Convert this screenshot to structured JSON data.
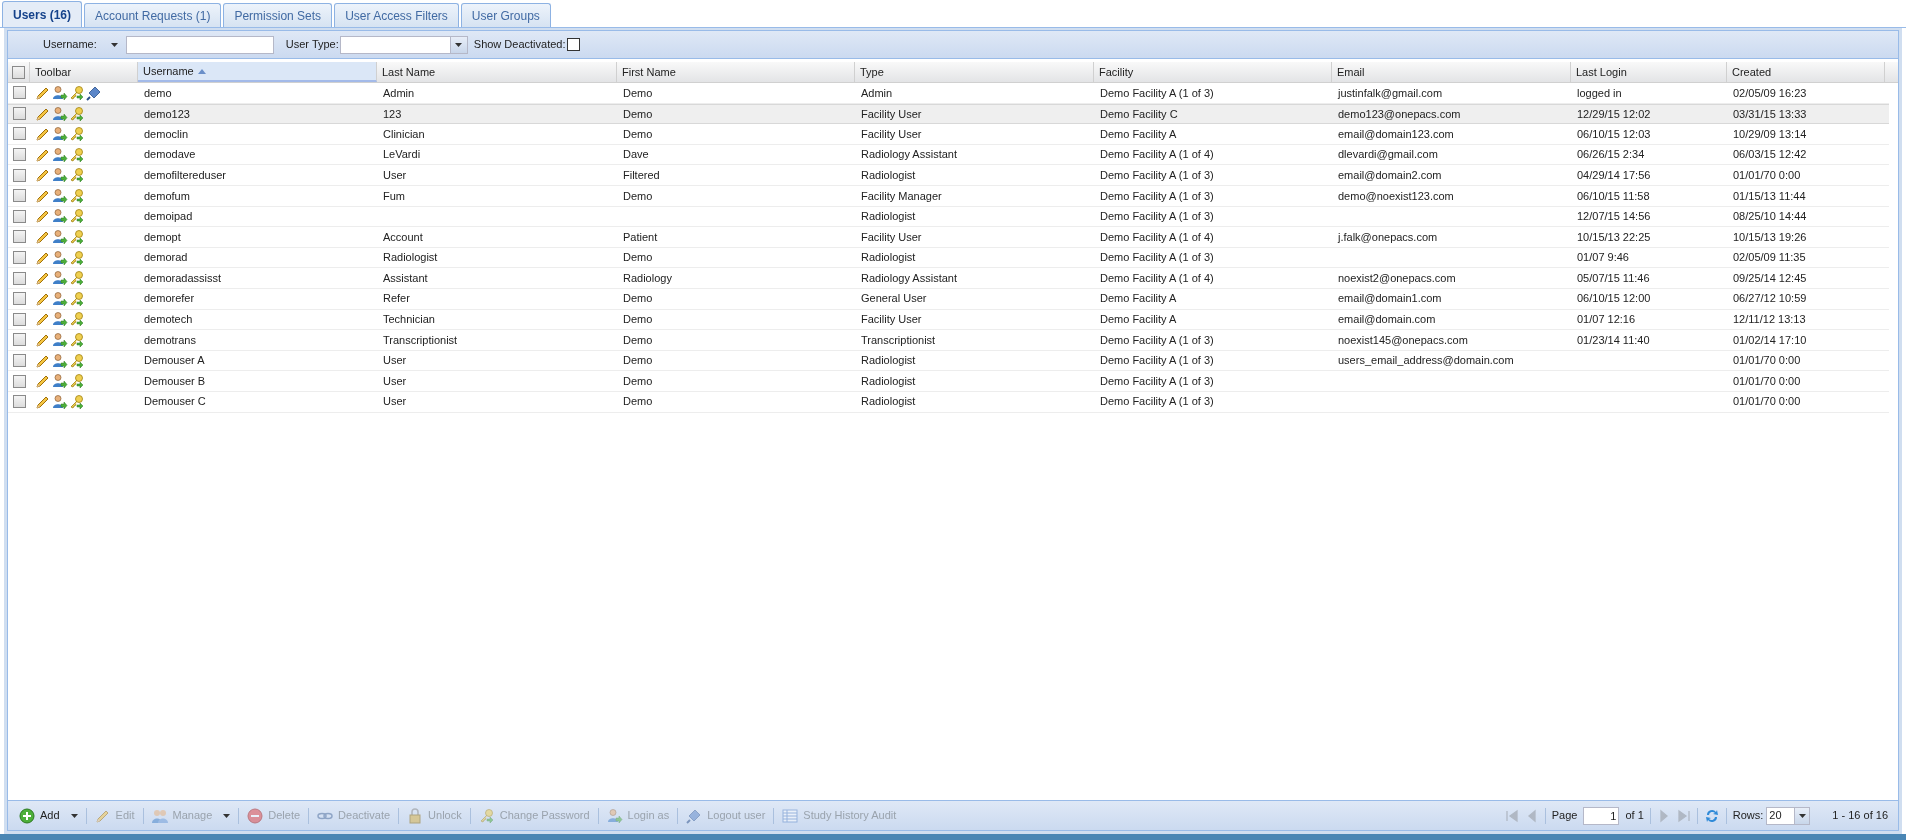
{
  "tabs": [
    {
      "label": "Users (16)",
      "selected": true
    },
    {
      "label": "Account Requests (1)",
      "selected": false
    },
    {
      "label": "Permission Sets",
      "selected": false
    },
    {
      "label": "User Access Filters",
      "selected": false
    },
    {
      "label": "User Groups",
      "selected": false
    }
  ],
  "filters": {
    "username_label": "Username:",
    "user_type_label": "User Type:",
    "show_deactivated_label": "Show Deactivated:",
    "show_deactivated": false
  },
  "grid": {
    "all_checked": false,
    "toolbar_column": "Toolbar",
    "columns": [
      {
        "label": "Username",
        "sorted": true
      },
      {
        "label": "Last Name",
        "sorted": false
      },
      {
        "label": "First Name",
        "sorted": false
      },
      {
        "label": "Type",
        "sorted": false
      },
      {
        "label": "Facility",
        "sorted": false
      },
      {
        "label": "Email",
        "sorted": false
      },
      {
        "label": "Last Login",
        "sorted": false
      },
      {
        "label": "Created",
        "sorted": false
      }
    ],
    "rows": [
      {
        "checked": false,
        "selected": false,
        "can_logout": true,
        "cells": [
          "demo",
          "Admin",
          "Demo",
          "Admin",
          "Demo Facility A (1 of 3)",
          "justinfalk@gmail.com",
          "logged in",
          "02/05/09 16:23"
        ]
      },
      {
        "checked": false,
        "selected": true,
        "can_logout": false,
        "cells": [
          "demo123",
          "123",
          "Demo",
          "Facility User",
          "Demo Facility C",
          "demo123@onepacs.com",
          "12/29/15 12:02",
          "03/31/15 13:33"
        ]
      },
      {
        "checked": false,
        "selected": false,
        "can_logout": false,
        "cells": [
          "democlin",
          "Clinician",
          "Demo",
          "Facility User",
          "Demo Facility A",
          "email@domain123.com",
          "06/10/15 12:03",
          "10/29/09 13:14"
        ]
      },
      {
        "checked": false,
        "selected": false,
        "can_logout": false,
        "cells": [
          "demodave",
          "LeVardi",
          "Dave",
          "Radiology Assistant",
          "Demo Facility A (1 of 4)",
          "dlevardi@gmail.com",
          "06/26/15 2:34",
          "06/03/15 12:42"
        ]
      },
      {
        "checked": false,
        "selected": false,
        "can_logout": false,
        "cells": [
          "demofiltereduser",
          "User",
          "Filtered",
          "Radiologist",
          "Demo Facility A (1 of 3)",
          "email@domain2.com",
          "04/29/14 17:56",
          "01/01/70 0:00"
        ]
      },
      {
        "checked": false,
        "selected": false,
        "can_logout": false,
        "cells": [
          "demofum",
          "Fum",
          "Demo",
          "Facility Manager",
          "Demo Facility A (1 of 3)",
          "demo@noexist123.com",
          "06/10/15 11:58",
          "01/15/13 11:44"
        ]
      },
      {
        "checked": false,
        "selected": false,
        "can_logout": false,
        "cells": [
          "demoipad",
          null,
          null,
          "Radiologist",
          "Demo Facility A (1 of 3)",
          null,
          "12/07/15 14:56",
          "08/25/10 14:44"
        ]
      },
      {
        "checked": false,
        "selected": false,
        "can_logout": false,
        "cells": [
          "demopt",
          "Account",
          "Patient",
          "Facility User",
          "Demo Facility A (1 of 4)",
          "j.falk@onepacs.com",
          "10/15/13 22:25",
          "10/15/13 19:26"
        ]
      },
      {
        "checked": false,
        "selected": false,
        "can_logout": false,
        "cells": [
          "demorad",
          "Radiologist",
          "Demo",
          "Radiologist",
          "Demo Facility A (1 of 3)",
          null,
          "01/07 9:46",
          "02/05/09 11:35"
        ]
      },
      {
        "checked": false,
        "selected": false,
        "can_logout": false,
        "cells": [
          "demoradassisst",
          "Assistant",
          "Radiology",
          "Radiology Assistant",
          "Demo Facility A (1 of 4)",
          "noexist2@onepacs.com",
          "05/07/15 11:46",
          "09/25/14 12:45"
        ]
      },
      {
        "checked": false,
        "selected": false,
        "can_logout": false,
        "cells": [
          "demorefer",
          "Refer",
          "Demo",
          "General User",
          "Demo Facility A",
          "email@domain1.com",
          "06/10/15 12:00",
          "06/27/12 10:59"
        ]
      },
      {
        "checked": false,
        "selected": false,
        "can_logout": false,
        "cells": [
          "demotech",
          "Technician",
          "Demo",
          "Facility User",
          "Demo Facility A",
          "email@domain.com",
          "01/07 12:16",
          "12/11/12 13:13"
        ]
      },
      {
        "checked": false,
        "selected": false,
        "can_logout": false,
        "cells": [
          "demotrans",
          "Transcriptionist",
          "Demo",
          "Transcriptionist",
          "Demo Facility A (1 of 3)",
          "noexist145@onepacs.com",
          "01/23/14 11:40",
          "01/02/14 17:10"
        ]
      },
      {
        "checked": false,
        "selected": false,
        "can_logout": false,
        "cells": [
          "Demouser A",
          "User",
          "Demo",
          "Radiologist",
          "Demo Facility A (1 of 3)",
          "users_email_address@domain.com",
          null,
          "01/01/70 0:00"
        ]
      },
      {
        "checked": false,
        "selected": false,
        "can_logout": false,
        "cells": [
          "Demouser B",
          "User",
          "Demo",
          "Radiologist",
          "Demo Facility A (1 of 3)",
          null,
          null,
          "01/01/70 0:00"
        ]
      },
      {
        "checked": false,
        "selected": false,
        "can_logout": false,
        "cells": [
          "Demouser C",
          "User",
          "Demo",
          "Radiologist",
          "Demo Facility A (1 of 3)",
          null,
          null,
          "01/01/70 0:00"
        ]
      }
    ]
  },
  "actions": [
    {
      "kind": "add",
      "label": "Add",
      "disabled": false,
      "has_menu": true
    },
    {
      "kind": "edit",
      "label": "Edit",
      "disabled": true,
      "has_menu": false
    },
    {
      "kind": "manage",
      "label": "Manage",
      "disabled": true,
      "has_menu": true
    },
    {
      "kind": "delete",
      "label": "Delete",
      "disabled": true,
      "has_menu": false
    },
    {
      "kind": "deactivate",
      "label": "Deactivate",
      "disabled": true,
      "has_menu": false
    },
    {
      "kind": "unlock",
      "label": "Unlock",
      "disabled": true,
      "has_menu": false
    },
    {
      "kind": "password",
      "label": "Change Password",
      "disabled": true,
      "has_menu": false
    },
    {
      "kind": "login",
      "label": "Login as",
      "disabled": true,
      "has_menu": false
    },
    {
      "kind": "logout",
      "label": "Logout user",
      "disabled": true,
      "has_menu": false
    },
    {
      "kind": "audit",
      "label": "Study History Audit",
      "disabled": true,
      "has_menu": false
    }
  ],
  "pager": {
    "first_disabled": true,
    "prev_disabled": true,
    "page_label": "Page",
    "page": "1",
    "of_label": "of 1",
    "next_disabled": true,
    "last_disabled": true,
    "rows_label": "Rows:",
    "rows": "20",
    "summary": "1 - 16 of 16"
  }
}
